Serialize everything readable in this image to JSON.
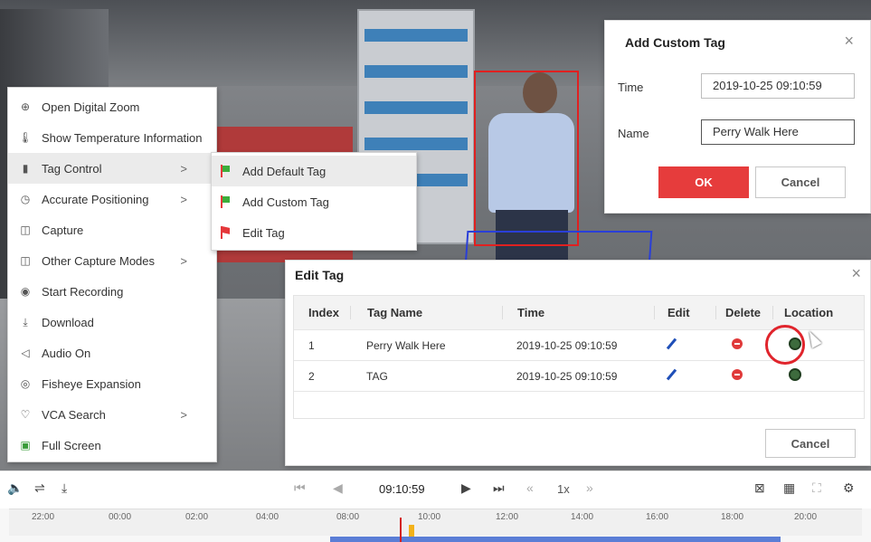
{
  "context_menu": {
    "items": [
      {
        "icon": "zoom-icon",
        "label": "Open Digital Zoom",
        "submenu": false
      },
      {
        "icon": "thermometer-icon",
        "label": "Show Temperature Information",
        "submenu": false
      },
      {
        "icon": "bookmark-icon",
        "label": "Tag Control",
        "submenu": true
      },
      {
        "icon": "timer-icon",
        "label": "Accurate Positioning",
        "submenu": true
      },
      {
        "icon": "camera-icon",
        "label": "Capture",
        "submenu": false
      },
      {
        "icon": "camera-icon",
        "label": "Other Capture Modes",
        "submenu": true
      },
      {
        "icon": "record-icon",
        "label": "Start Recording",
        "submenu": false
      },
      {
        "icon": "download-icon",
        "label": "Download",
        "submenu": false
      },
      {
        "icon": "speaker-muted-icon",
        "label": "Audio On",
        "submenu": false
      },
      {
        "icon": "fisheye-icon",
        "label": "Fisheye Expansion",
        "submenu": false
      },
      {
        "icon": "bulb-icon",
        "label": "VCA Search",
        "submenu": true
      },
      {
        "icon": "fullscreen-icon",
        "label": "Full Screen",
        "submenu": false
      }
    ],
    "submenu_arrow": ">"
  },
  "tag_submenu": {
    "items": [
      {
        "label": "Add Default Tag"
      },
      {
        "label": "Add Custom Tag"
      },
      {
        "label": "Edit Tag"
      }
    ]
  },
  "add_custom_tag": {
    "title": "Add Custom Tag",
    "close": "×",
    "time_label": "Time",
    "time_value": "2019-10-25 09:10:59",
    "name_label": "Name",
    "name_value": "Perry Walk Here",
    "ok": "OK",
    "cancel": "Cancel"
  },
  "edit_tag": {
    "title": "Edit Tag",
    "close": "×",
    "columns": [
      "Index",
      "Tag Name",
      "Time",
      "Edit",
      "Delete",
      "Location"
    ],
    "rows": [
      {
        "index": "1",
        "name": "Perry Walk Here",
        "time": "2019-10-25 09:10:59"
      },
      {
        "index": "2",
        "name": "TAG",
        "time": "2019-10-25 09:10:59"
      }
    ],
    "cancel": "Cancel"
  },
  "playback": {
    "time": "09:10:59",
    "speed": "1x",
    "icons": [
      "speaker-icon",
      "adjust-icon",
      "download-icon",
      "frame-back-icon",
      "step-back-icon",
      "play-icon",
      "step-forward-icon",
      "slow-icon",
      "fast-icon",
      "close-window-icon",
      "layout-icon",
      "fullscreen-icon",
      "settings-icon"
    ]
  },
  "timeline": {
    "labels": [
      "22:00",
      "00:00",
      "02:00",
      "04:00",
      "08:00",
      "10:00",
      "12:00",
      "14:00",
      "16:00",
      "18:00",
      "20:00"
    ]
  },
  "colors": {
    "accent_red": "#e63c3c",
    "timeline_blue": "#5b7ed6",
    "vca_red": "#e02020",
    "vca_blue": "#2a3fd8"
  }
}
